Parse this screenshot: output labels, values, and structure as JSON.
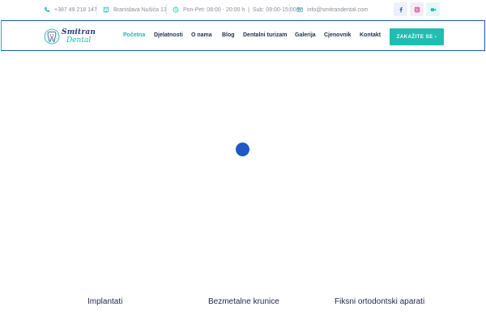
{
  "topbar": {
    "phone": "+387 49 218 147",
    "address": "Branislava Nušića 13",
    "hours": "Pon-Pet: 08:00 - 20:00 h  |  Sub: 09:00-15:00 h",
    "email": "info@smitrandental.com",
    "social": [
      "facebook-icon",
      "instagram-icon",
      "video-icon"
    ]
  },
  "logo": {
    "line1": "Smitran",
    "line2": "Dental"
  },
  "nav": {
    "items": [
      "Početna",
      "Djelatnosti",
      "O nama",
      "Blog",
      "Dentalni turizam",
      "Galerija",
      "Cjenovnik",
      "Kontakt"
    ],
    "active": "Početna",
    "cta": "ZAKAŽITE SE ›"
  },
  "services": [
    "Implantati",
    "Bezmetalne krunice",
    "Fiksni ortodontski aparati"
  ],
  "colors": {
    "accent": "#22bdb1",
    "primary": "#1f58c9",
    "text": "#1e2a45"
  }
}
